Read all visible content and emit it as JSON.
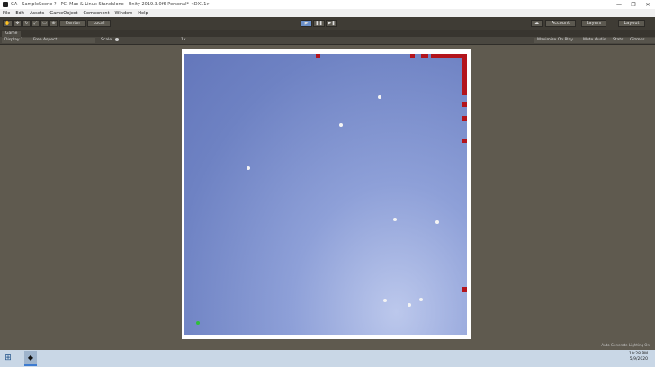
{
  "window": {
    "title": "GA - SampleScene ? - PC, Mac & Linux Standalone - Unity 2019.3.0f6 Personal* <DX11>",
    "minimize": "—",
    "maximize": "❐",
    "close": "✕"
  },
  "menu": [
    "File",
    "Edit",
    "Assets",
    "GameObject",
    "Component",
    "Window",
    "Help"
  ],
  "toolbar": {
    "center_label": "Center",
    "local_label": "Local",
    "account_label": "Account",
    "layers_label": "Layers",
    "layout_label": "Layout"
  },
  "tab": {
    "label": "Game"
  },
  "gamebar": {
    "display": "Display 1",
    "aspect": "Free Aspect",
    "scale_label": "Scale",
    "scale_value": "1x",
    "maximize_on_play": "Maximize On Play",
    "mute_audio": "Mute Audio",
    "stats": "Stats",
    "gizmos": "Gizmos"
  },
  "status": {
    "text": "Auto Generate Lighting On"
  },
  "taskbar": {
    "time": "10:28 PM",
    "date": "5/9/2020"
  },
  "icons": [
    "unity-icon",
    "move-tool-icon",
    "play-icon",
    "pause-icon",
    "step-icon",
    "cloud-icon",
    "windows-start-icon"
  ]
}
